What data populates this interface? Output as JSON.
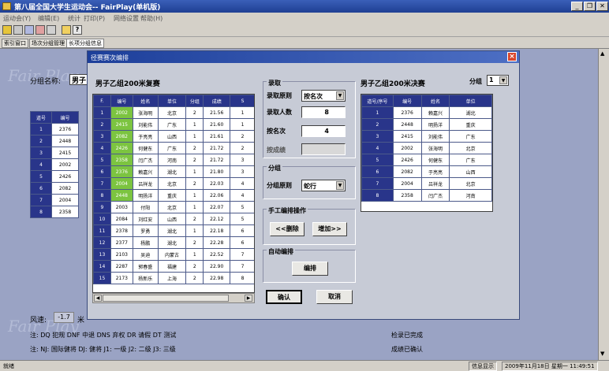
{
  "app": {
    "title": "第八届全国大学生运动会-- FairPlay(单机版)"
  },
  "menu": [
    "运动会(Y)",
    "编辑(E)",
    "统计",
    "打印(P)",
    "网络设置",
    "帮助(H)"
  ],
  "tabs": [
    "索引窗口",
    "场次分组管理",
    "长项分组信息"
  ],
  "background": {
    "group_name_label": "分组名称:",
    "group_name_value": "男子",
    "watermark": "Fair Play",
    "small_table": {
      "headers": [
        "道号",
        "编号"
      ],
      "rows": [
        [
          "1",
          "2376"
        ],
        [
          "2",
          "2448"
        ],
        [
          "3",
          "2415"
        ],
        [
          "4",
          "2002"
        ],
        [
          "5",
          "2426"
        ],
        [
          "6",
          "2082"
        ],
        [
          "7",
          "2004"
        ],
        [
          "8",
          "2358"
        ]
      ]
    },
    "wind_label": "风速:",
    "wind_value": "-1.7",
    "wind_unit": "米",
    "notes_line1": "注: DQ 犯规   DNF 中退   DNS 弃权   DR 请假   DT 测试",
    "notes_line2": "注: NJ: 国际健将   DJ: 健将   J1: 一级   J2: 二级   J3: 三级",
    "status_done": "检录已完成",
    "status_confirmed": "成绩已确认"
  },
  "dialog": {
    "title": "径赛赛次编排",
    "left_title": "男子乙组200米复赛",
    "left_headers": [
      "F.",
      "编号",
      "姓名",
      "单位",
      "分组",
      "成绩",
      "S"
    ],
    "left_rows": [
      [
        "1",
        "2002",
        "张海明",
        "北京",
        "2",
        "21.56",
        "1"
      ],
      [
        "2",
        "2415",
        "刘能伟",
        "广东",
        "1",
        "21.60",
        "1"
      ],
      [
        "3",
        "2082",
        "于亮亮",
        "山西",
        "1",
        "21.61",
        "2"
      ],
      [
        "4",
        "2426",
        "何健东",
        "广东",
        "2",
        "21.72",
        "2"
      ],
      [
        "5",
        "2358",
        "闫广杰",
        "河南",
        "2",
        "21.72",
        "3"
      ],
      [
        "6",
        "2376",
        "赖嘉兴",
        "湖北",
        "1",
        "21.80",
        "3"
      ],
      [
        "7",
        "2004",
        "吕祥龙",
        "北京",
        "2",
        "22.03",
        "4"
      ],
      [
        "8",
        "2448",
        "明扬洋",
        "重庆",
        "1",
        "22.06",
        "4"
      ],
      [
        "9",
        "2003",
        "付阳",
        "北京",
        "1",
        "22.07",
        "5"
      ],
      [
        "10",
        "2084",
        "刘红安",
        "山西",
        "2",
        "22.12",
        "5"
      ],
      [
        "11",
        "2378",
        "罗勇",
        "湖北",
        "1",
        "22.18",
        "6"
      ],
      [
        "12",
        "2377",
        "杨鹏",
        "湖北",
        "2",
        "22.28",
        "6"
      ],
      [
        "13",
        "2103",
        "吴迪",
        "内蒙古",
        "1",
        "22.52",
        "7"
      ],
      [
        "14",
        "2287",
        "郭春盛",
        "福建",
        "2",
        "22.90",
        "7"
      ],
      [
        "15",
        "2173",
        "杨新乐",
        "上海",
        "2",
        "22.98",
        "8"
      ]
    ],
    "admission": {
      "title": "录取",
      "rule_label": "录取原则",
      "rule_value": "按名次",
      "count_label": "录取人数",
      "count_value": "8",
      "rank_label": "按名次",
      "rank_value": "4",
      "score_label": "按成绩",
      "score_value": ""
    },
    "grouping": {
      "title": "分组",
      "rule_label": "分组原则",
      "rule_value": "蛇行"
    },
    "manual": {
      "title": "手工编排操作",
      "delete_button": "<<删除",
      "add_button": "增加>>"
    },
    "auto": {
      "title": "自动编排",
      "arrange_button": "编排"
    },
    "ok_button": "确认",
    "cancel_button": "取消",
    "right_title": "男子乙组200米决赛",
    "group_label": "分组",
    "group_value": "1",
    "right_headers": [
      "道号/序号",
      "编号",
      "姓名",
      "单位"
    ],
    "right_rows": [
      [
        "1",
        "2376",
        "赖嘉兴",
        "湖北"
      ],
      [
        "2",
        "2448",
        "明扬洋",
        "重庆"
      ],
      [
        "3",
        "2415",
        "刘能伟",
        "广东"
      ],
      [
        "4",
        "2002",
        "张海明",
        "北京"
      ],
      [
        "5",
        "2426",
        "何健东",
        "广东"
      ],
      [
        "6",
        "2082",
        "于亮亮",
        "山西"
      ],
      [
        "7",
        "2004",
        "吕祥龙",
        "北京"
      ],
      [
        "8",
        "2358",
        "闫广杰",
        "河南"
      ]
    ]
  },
  "statusbar": {
    "left": "就绪",
    "info": "信息显示",
    "datetime": "2009年11月18日  星期一  11:49:51"
  }
}
